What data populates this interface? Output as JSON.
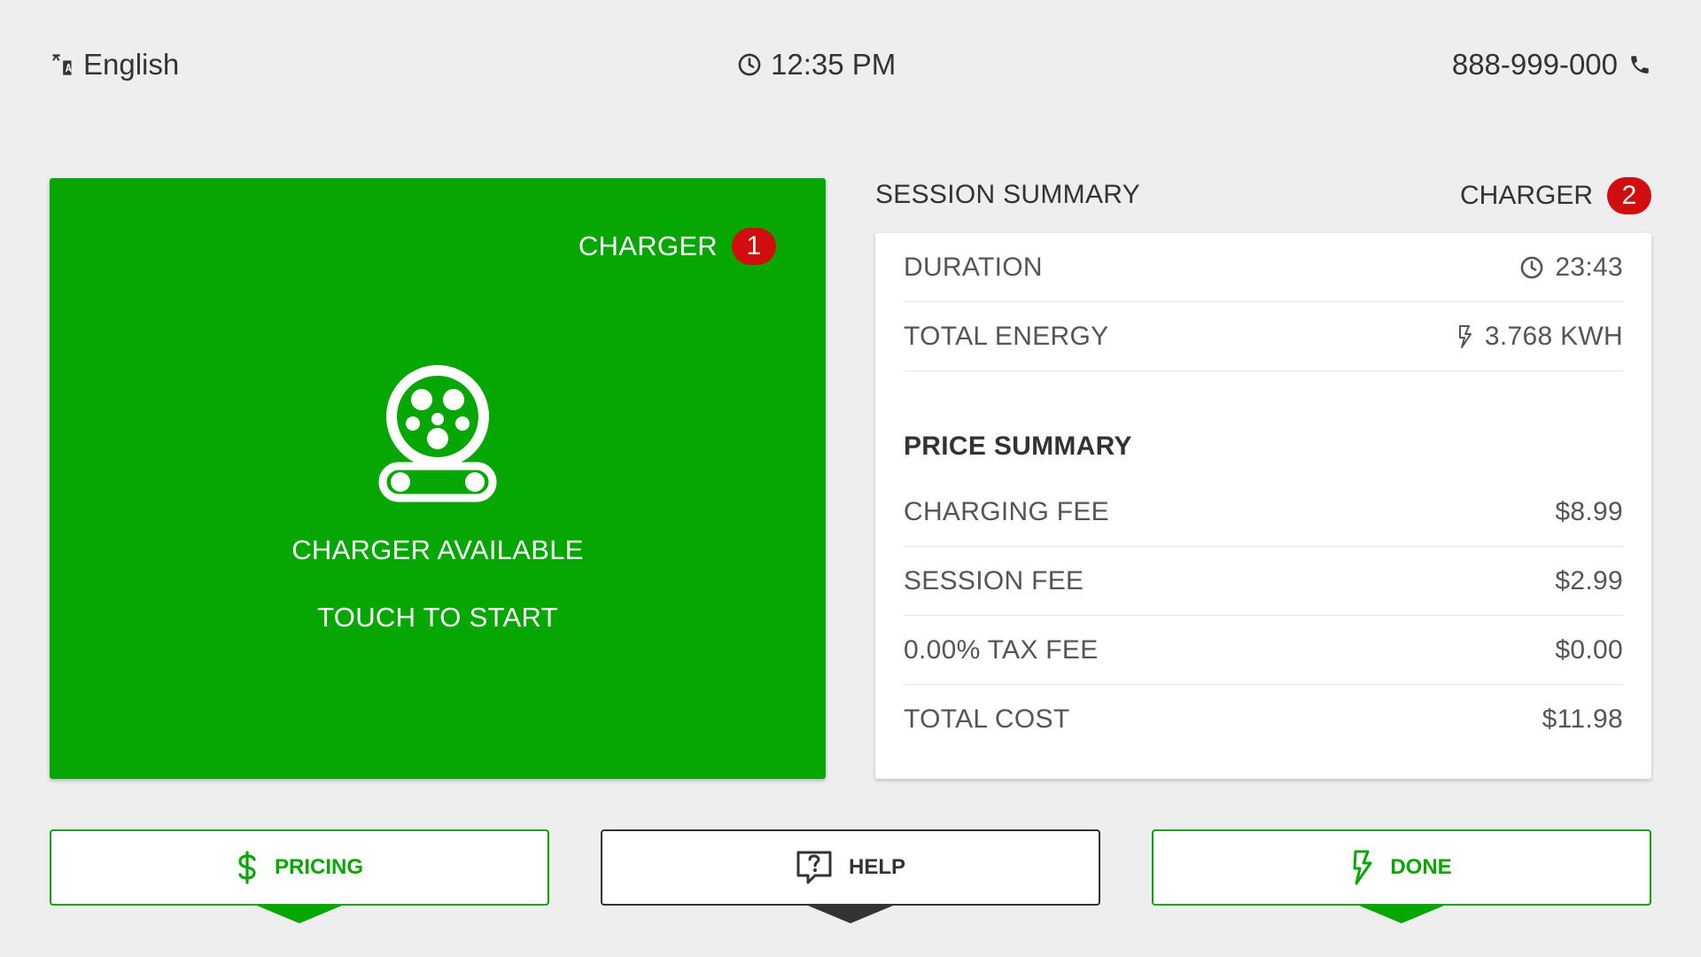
{
  "topbar": {
    "language": "English",
    "time": "12:35 PM",
    "phone": "888-999-000"
  },
  "charger_card": {
    "title": "CHARGER",
    "number": "1",
    "status": "CHARGER AVAILABLE",
    "action": "TOUCH TO START",
    "color": "#06a603"
  },
  "session": {
    "title": "SESSION SUMMARY",
    "charger_label": "CHARGER",
    "charger_number": "2",
    "duration_label": "DURATION",
    "duration_value": "23:43",
    "energy_label": "TOTAL ENERGY",
    "energy_value": "3.768 KWH"
  },
  "price": {
    "title": "PRICE SUMMARY",
    "rows": [
      {
        "label": "CHARGING FEE",
        "value": "$8.99"
      },
      {
        "label": "SESSION FEE",
        "value": "$2.99"
      },
      {
        "label": "0.00% TAX FEE",
        "value": "$0.00"
      },
      {
        "label": "TOTAL COST",
        "value": "$11.98"
      }
    ]
  },
  "buttons": {
    "pricing": "PRICING",
    "help": "HELP",
    "done": "DONE"
  },
  "colors": {
    "accent": "#06a603",
    "badge": "#d10d10",
    "background": "#eeeeee"
  }
}
